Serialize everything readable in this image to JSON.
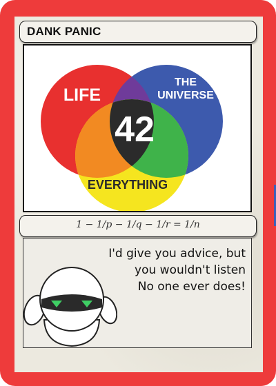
{
  "card": {
    "title": "DANK PANIC",
    "type_line": "1 − 1/p − 1/q − 1/r = 1/n",
    "flavor_lines": [
      "I'd give you advice, but",
      "you wouldn't listen",
      "No one ever does!"
    ]
  },
  "venn": {
    "left_label": "LIFE",
    "right_label_line1": "THE",
    "right_label_line2": "UNIVERSE",
    "bottom_label": "EVERYTHING",
    "center_label": "42"
  },
  "colors": {
    "frame": "#ee3b3b",
    "circle_red": "#e8302f",
    "circle_blue": "#3d5aad",
    "circle_yellow": "#f5e51f",
    "overlap_purple": "#6f3b9a",
    "overlap_orange": "#f28a22",
    "overlap_green": "#3fb34a",
    "center_dark": "#2b2b2b"
  },
  "art_icon": "marvin-robot-icon"
}
